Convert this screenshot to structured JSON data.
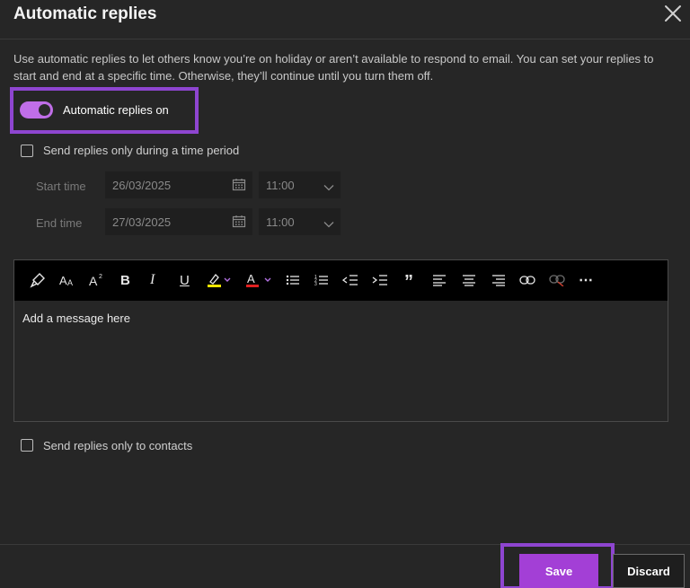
{
  "dialog": {
    "title": "Automatic replies",
    "description": "Use automatic replies to let others know you’re on holiday or aren’t available to respond to email. You can set your replies to start and end at a specific time. Otherwise, they’ll continue until you turn them off."
  },
  "toggle": {
    "label": "Automatic replies on",
    "on": true
  },
  "time_period": {
    "checkbox_label": "Send replies only during a time period",
    "checked": false,
    "start_label": "Start time",
    "start_date": "26/03/2025",
    "start_time": "11:00",
    "end_label": "End time",
    "end_date": "27/03/2025",
    "end_time": "11:00"
  },
  "editor": {
    "placeholder": "Add a message here",
    "toolbar": {
      "bold": "B",
      "italic": "I",
      "underline": "U",
      "more": "⋯",
      "quote": "”"
    }
  },
  "contacts": {
    "checkbox_label": "Send replies only to contacts",
    "checked": false
  },
  "footer": {
    "save_label": "Save",
    "discard_label": "Discard"
  },
  "colors": {
    "accent": "#a33fd6",
    "highlight": "#8e45d0",
    "toggle": "#c06ee8",
    "background": "#262626"
  }
}
